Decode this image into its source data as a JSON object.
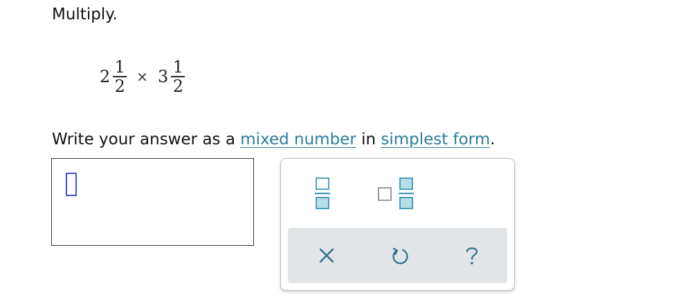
{
  "instruction": "Multiply.",
  "expression": {
    "term1": {
      "whole": "2",
      "numerator": "1",
      "denominator": "2"
    },
    "operator": "×",
    "term2": {
      "whole": "3",
      "numerator": "1",
      "denominator": "2"
    }
  },
  "prompt": {
    "prefix": "Write your answer as a ",
    "link1": "mixed number",
    "middle": " in ",
    "link2": "simplest form",
    "suffix": "."
  },
  "answer": {
    "value": ""
  },
  "keypad": {
    "keys": [
      {
        "name": "fraction",
        "icon": "fraction-template-icon"
      },
      {
        "name": "mixed-number",
        "icon": "mixed-number-template-icon"
      },
      {
        "name": "clear",
        "icon": "close-icon"
      },
      {
        "name": "undo",
        "icon": "undo-icon"
      },
      {
        "name": "help",
        "icon": "help-icon"
      }
    ]
  },
  "colors": {
    "link": "#2a7d9c",
    "slot_cursor": "#3f51d6",
    "template_box_fill": "#b8dde8",
    "template_box_stroke": "#3b98b8",
    "keypad_bottom_bg": "#e1e5e8",
    "keypad_icon": "#2e6f8a"
  }
}
